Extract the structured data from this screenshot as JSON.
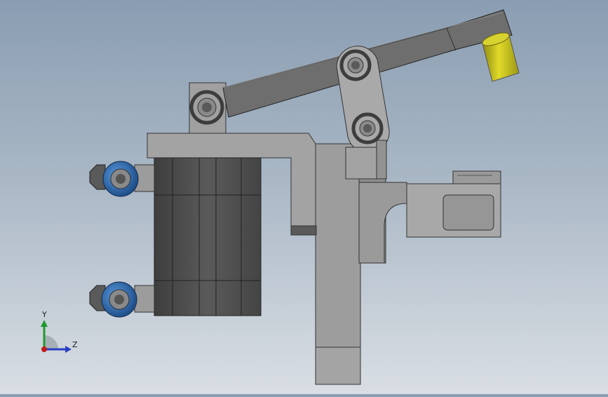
{
  "colors": {
    "background_top": "#8a9db2",
    "background_bottom": "#d9dee4",
    "steel_dark": "#4e4e4e",
    "steel_mid": "#6f6f6f",
    "steel_light": "#9b9b9b",
    "link_gray": "#a8a8a8",
    "fitting_blue": "#2f6fb3",
    "pad_yellow": "#c9c21a",
    "axis_y": "#1f9a2e",
    "axis_z": "#2a3fc4",
    "axis_origin": "#c41a1a"
  },
  "triad": {
    "y_label": "Y",
    "z_label": "Z"
  },
  "icons": {
    "coordinate_triad": "coordinate-triad-icon"
  }
}
